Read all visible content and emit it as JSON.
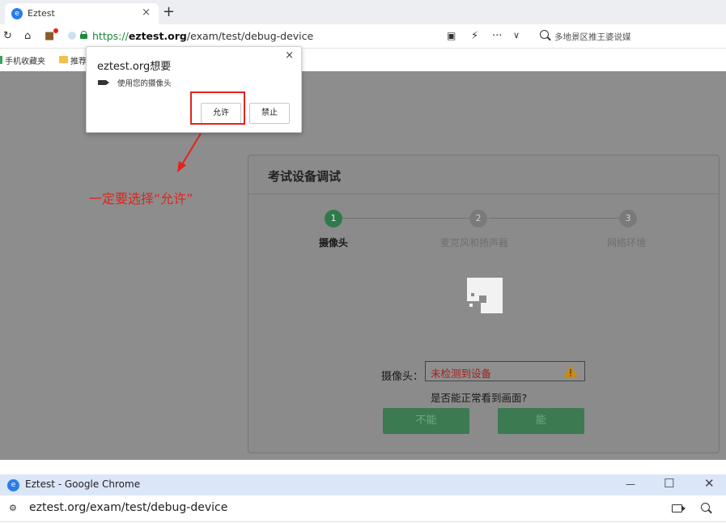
{
  "browser": {
    "tab_title": "Eztest",
    "tab_close": "×",
    "new_tab": "+",
    "url_https": "https://",
    "url_host": "eztest.org",
    "url_path": "/exam/test/debug-device",
    "search_text": "多地景区推王婆说媒",
    "toolbar_icons": [
      "refresh-icon",
      "home-icon",
      "extension-icon",
      "screenshot-icon",
      "lightning-icon",
      "more-icon",
      "chevron-down-icon",
      "search-icon"
    ]
  },
  "bookmarks": {
    "items": [
      "手机收藏夹",
      "推荐"
    ]
  },
  "permission_popup": {
    "title": "eztest.org想要",
    "close": "×",
    "permission": "使用您的摄像头",
    "allow_label": "允许",
    "block_label": "禁止"
  },
  "annotation": {
    "text": "一定要选择“允许”",
    "color": "#e3231c"
  },
  "card": {
    "title": "考试设备调试",
    "steps": [
      {
        "number": "1",
        "label": "摄像头",
        "active": true
      },
      {
        "number": "2",
        "label": "麦克风和扬声器",
        "active": false
      },
      {
        "number": "3",
        "label": "网络环境",
        "active": false
      }
    ],
    "camera_label": "摄像头：",
    "camera_status": "未检测到设备",
    "question": "是否能正常看到画面?",
    "no_label": "不能",
    "yes_label": "能",
    "accent_color": "#2f7a4b"
  },
  "bottom_window": {
    "title": "Eztest - Google Chrome",
    "minimize": "—",
    "maximize": "☐",
    "close": "✕",
    "url": "eztest.org/exam/test/debug-device"
  }
}
